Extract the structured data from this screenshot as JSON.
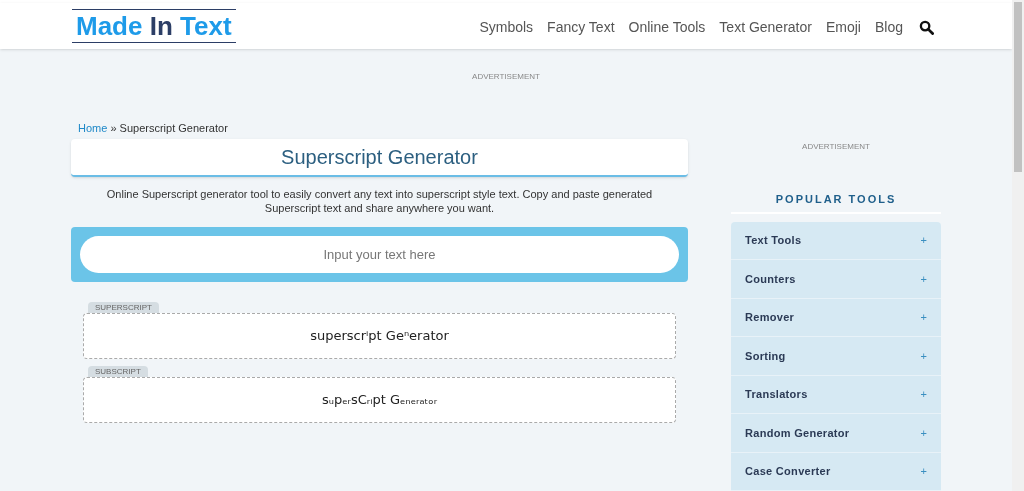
{
  "header": {
    "logo": {
      "part1": "Made",
      "part2": "In",
      "part3": "Text"
    },
    "nav": [
      "Symbols",
      "Fancy Text",
      "Online Tools",
      "Text Generator",
      "Emoji",
      "Blog"
    ]
  },
  "top_ad": "ADVERTISEMENT",
  "breadcrumb": {
    "home": "Home",
    "separator": "»",
    "current": "Superscript Generator"
  },
  "title": "Superscript Generator",
  "description": "Online Superscript generator tool to easily convert any text into superscript style text. Copy and paste generated Superscript text and share anywhere you want.",
  "input": {
    "placeholder": "Input your text here"
  },
  "outputs": [
    {
      "label": "SUPERSCRIPT",
      "text": "superscrⁱpt Geⁿerator"
    },
    {
      "label": "SUBSCRIPT",
      "text": "sᵤpₑᵣsCᵣᵢpt Gₑₙₑᵣₐₜₒᵣ"
    }
  ],
  "sidebar": {
    "ad": "ADVERTISEMENT",
    "heading": "POPULAR TOOLS",
    "items": [
      {
        "label": "Text Tools",
        "toggle": "+"
      },
      {
        "label": "Counters",
        "toggle": "+"
      },
      {
        "label": "Remover",
        "toggle": "+"
      },
      {
        "label": "Sorting",
        "toggle": "+"
      },
      {
        "label": "Translators",
        "toggle": "+"
      },
      {
        "label": "Random Generator",
        "toggle": "+"
      },
      {
        "label": "Case Converter",
        "toggle": "+"
      }
    ]
  }
}
